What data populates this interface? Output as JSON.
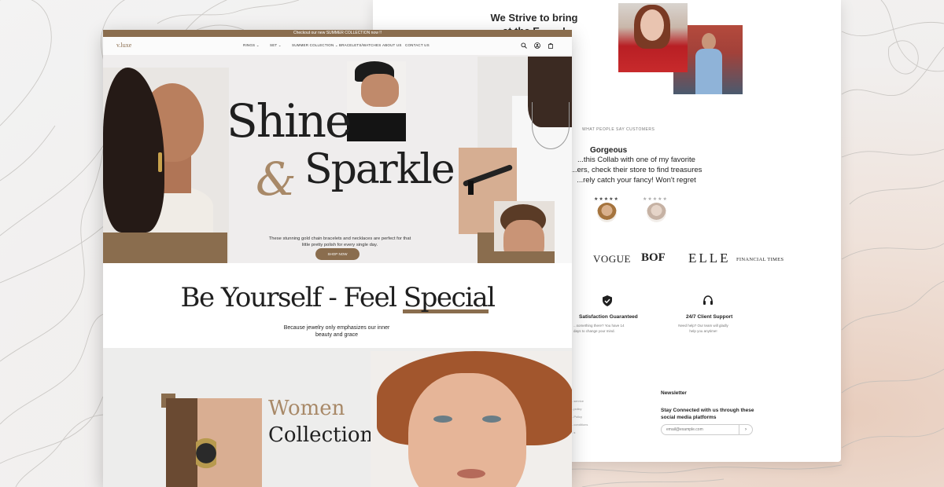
{
  "main": {
    "promo": "Checkout our new SUMMER COLLECTION now !!",
    "brand": "v.luxe",
    "nav": [
      {
        "label": "RINGS ⌄"
      },
      {
        "label": "SET ⌄"
      },
      {
        "label": "SUMMER COLLECTION ⌄"
      },
      {
        "label": "BRACELETS/WATCHES"
      },
      {
        "label": "ABOUT US"
      },
      {
        "label": "CONTACT US"
      }
    ],
    "hero": {
      "title_line1": "Shine",
      "ampersand": "&",
      "title_line2": "Sparkle",
      "description": "These stunning gold chain bracelets and necklaces are perfect for that little pretty polish for every single day.",
      "cta": "SHOP NOW"
    },
    "tagline": {
      "text": "Be Yourself - Feel Special",
      "sub": "Because jewelry only emphasizes our inner beauty and grace"
    },
    "collection": {
      "line1": "Women",
      "line2": "Collection"
    }
  },
  "back": {
    "strive": "We Strive to bring",
    "strive_line2": "at the E... ... !",
    "reviews_label": "WHAT PEOPLE SAY CUSTOMERS",
    "review_title": "Gorgeous",
    "review_text": "...this Collab with one of my favorite ...ers, check their store to find treasures ...rely catch your fancy! Won't regret",
    "stars_1": "★★★★★",
    "stars_2": "★★★★★",
    "press": [
      "VOGUE",
      "BOF",
      "ELLE",
      "FINANCIAL TIMES"
    ],
    "features": [
      {
        "title": "Satisfaction Guaranteed",
        "desc": "...something there? You have 14 days to change your mind."
      },
      {
        "title": "24/7 Client Support",
        "desc": "Need help? Our team will gladly help you anytime!"
      }
    ],
    "newsletter": {
      "title": "Newsletter",
      "subtitle": "Stay Connected with us through these social media platforms",
      "placeholder": "email@example.com",
      "button": "›"
    },
    "footer_links": [
      "...service",
      "...policy",
      "...Policy",
      "...conditions",
      "...s"
    ]
  },
  "colors": {
    "accent": "#8a6d4e",
    "accent_light": "#a88968",
    "text": "#1f1f1f"
  }
}
